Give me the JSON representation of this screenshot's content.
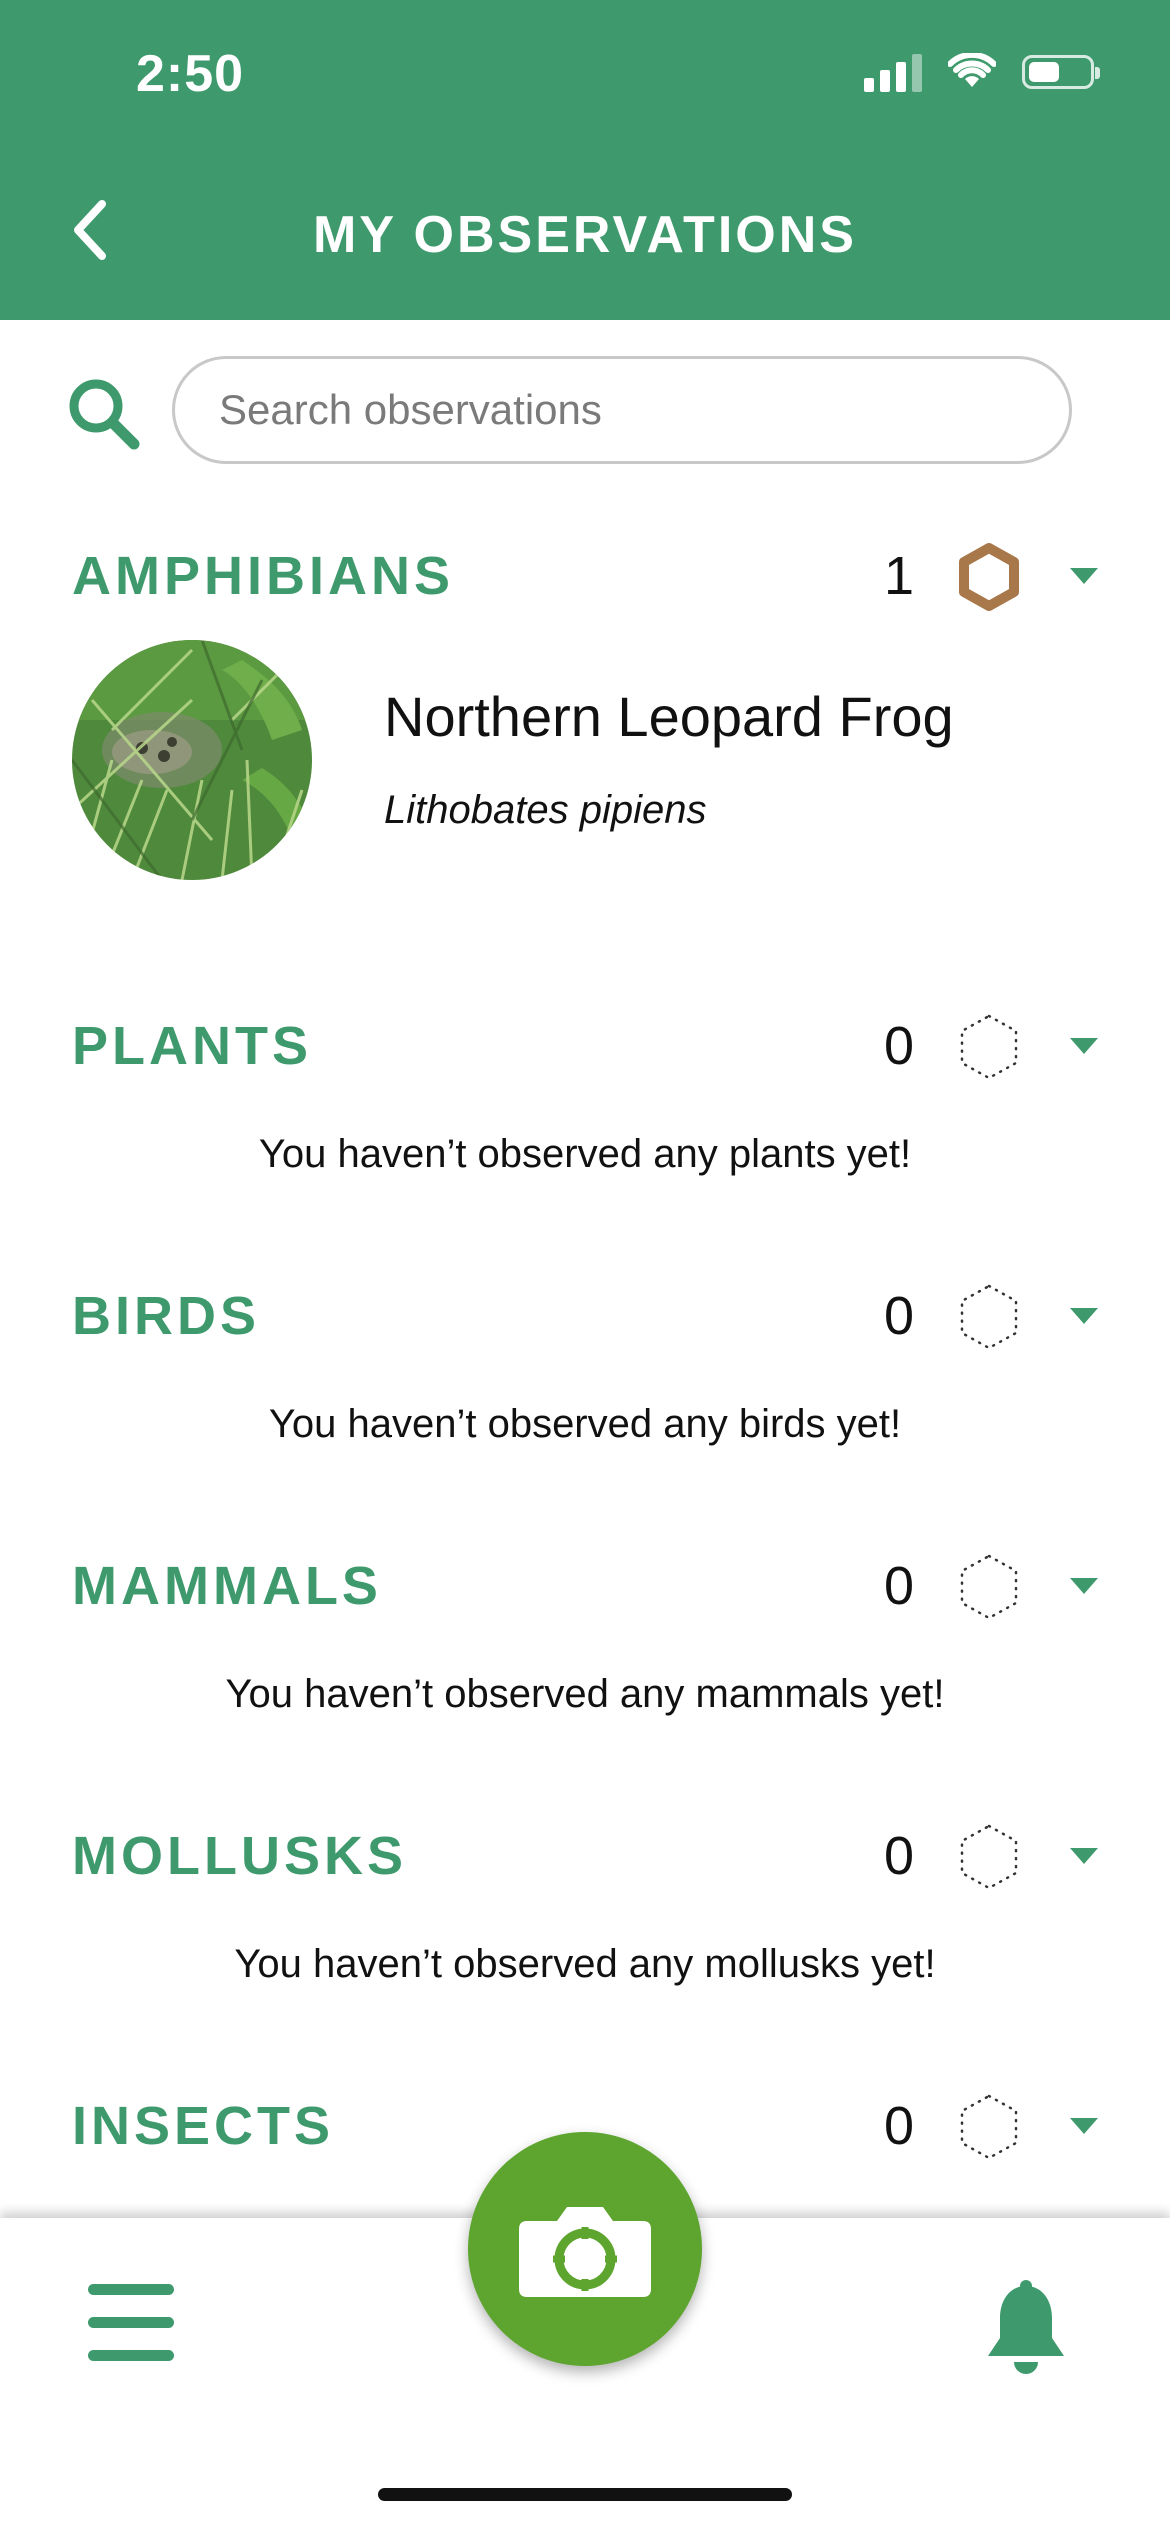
{
  "status_bar": {
    "time": "2:50"
  },
  "header": {
    "title": "MY OBSERVATIONS",
    "back_icon": "chevron-left-icon"
  },
  "search": {
    "placeholder": "Search observations",
    "value": "",
    "icon": "search-icon"
  },
  "colors": {
    "brand_green": "#3e9a6d",
    "camera_green": "#5da52e",
    "badge_bronze": "#a8784a",
    "white": "#ffffff"
  },
  "sections": [
    {
      "title": "AMPHIBIANS",
      "count": "1",
      "badge": "bronze-hexagon-badge",
      "observations": [
        {
          "common_name": "Northern Leopard Frog",
          "scientific_name": "Lithobates pipiens"
        }
      ]
    },
    {
      "title": "PLANTS",
      "count": "0",
      "badge": "empty-dotted-badge",
      "empty_message": "You haven’t observed any plants yet!"
    },
    {
      "title": "BIRDS",
      "count": "0",
      "badge": "empty-dotted-badge",
      "empty_message": "You haven’t observed any birds yet!"
    },
    {
      "title": "MAMMALS",
      "count": "0",
      "badge": "empty-dotted-badge",
      "empty_message": "You haven’t observed any mammals yet!"
    },
    {
      "title": "MOLLUSKS",
      "count": "0",
      "badge": "empty-dotted-badge",
      "empty_message": "You haven’t observed any mollusks yet!"
    },
    {
      "title": "INSECTS",
      "count": "0",
      "badge": "empty-dotted-badge"
    }
  ],
  "bottom_bar": {
    "menu_icon": "hamburger-menu-icon",
    "camera_icon": "camera-icon",
    "bell_icon": "bell-icon"
  }
}
